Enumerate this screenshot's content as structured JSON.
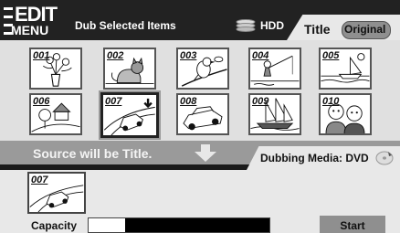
{
  "header": {
    "edit_label": "EDIT",
    "menu_label": "MENU",
    "subtitle": "Dub Selected Items",
    "source_label": "HDD",
    "tab_label": "Title",
    "mode_label": "Original"
  },
  "titles": [
    {
      "number": "001",
      "scene": "flowers-in-vase",
      "selected": false
    },
    {
      "number": "002",
      "scene": "cat",
      "selected": false
    },
    {
      "number": "003",
      "scene": "bird-on-branch",
      "selected": false
    },
    {
      "number": "004",
      "scene": "fisherman",
      "selected": false
    },
    {
      "number": "005",
      "scene": "sailboat",
      "selected": false
    },
    {
      "number": "006",
      "scene": "house",
      "selected": false
    },
    {
      "number": "007",
      "scene": "car-on-road",
      "selected": true
    },
    {
      "number": "008",
      "scene": "car",
      "selected": false
    },
    {
      "number": "009",
      "scene": "sailing-ship",
      "selected": false
    },
    {
      "number": "010",
      "scene": "people",
      "selected": false
    }
  ],
  "info": {
    "source_text": "Source will be Title.",
    "media_text": "Dubbing Media: DVD"
  },
  "selection": {
    "number": "007",
    "scene": "car-on-road"
  },
  "capacity": {
    "label": "Capacity",
    "used_fraction": 0.2
  },
  "actions": {
    "start_label": "Start"
  },
  "colors": {
    "bar_dark": "#222222",
    "grid_bg": "#e0e0e0",
    "info_bar": "#9a9a9a",
    "button": "#8f8f8f"
  }
}
